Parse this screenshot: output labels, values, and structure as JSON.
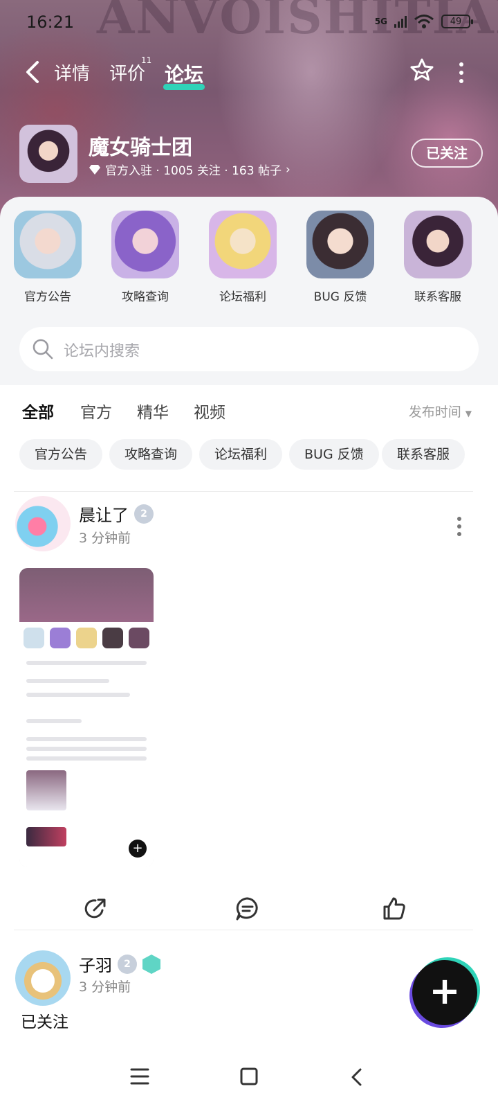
{
  "status_bar": {
    "time": "16:21",
    "network": "5G",
    "battery": "49"
  },
  "header": {
    "bg_text": "ANVOISHITIAN",
    "tabs": [
      {
        "label": "详情",
        "active": false
      },
      {
        "label": "评价",
        "active": false,
        "badge": "11"
      },
      {
        "label": "论坛",
        "active": true
      }
    ]
  },
  "game": {
    "name": "魔女骑士团",
    "meta": "官方入驻 · 1005 关注 · 163 帖子",
    "follow_label": "已关注"
  },
  "quick_links": [
    {
      "label": "官方公告"
    },
    {
      "label": "攻略查询"
    },
    {
      "label": "论坛福利"
    },
    {
      "label": "BUG 反馈"
    },
    {
      "label": "联系客服"
    }
  ],
  "search": {
    "placeholder": "论坛内搜索"
  },
  "filter_tabs": [
    {
      "label": "全部",
      "active": true
    },
    {
      "label": "官方",
      "active": false
    },
    {
      "label": "精华",
      "active": false
    },
    {
      "label": "视频",
      "active": false
    }
  ],
  "sort_label": "发布时间",
  "chips": [
    "官方公告",
    "攻略查询",
    "论坛福利",
    "BUG 反馈",
    "联系客服"
  ],
  "posts": [
    {
      "author": "晨让了",
      "level": "2",
      "time": "3 分钟前"
    },
    {
      "author": "子羽",
      "level": "2",
      "time": "3 分钟前",
      "body": "已关注"
    }
  ],
  "colors": {
    "accent": "#2fd3b8",
    "banner": "#7a5870"
  }
}
